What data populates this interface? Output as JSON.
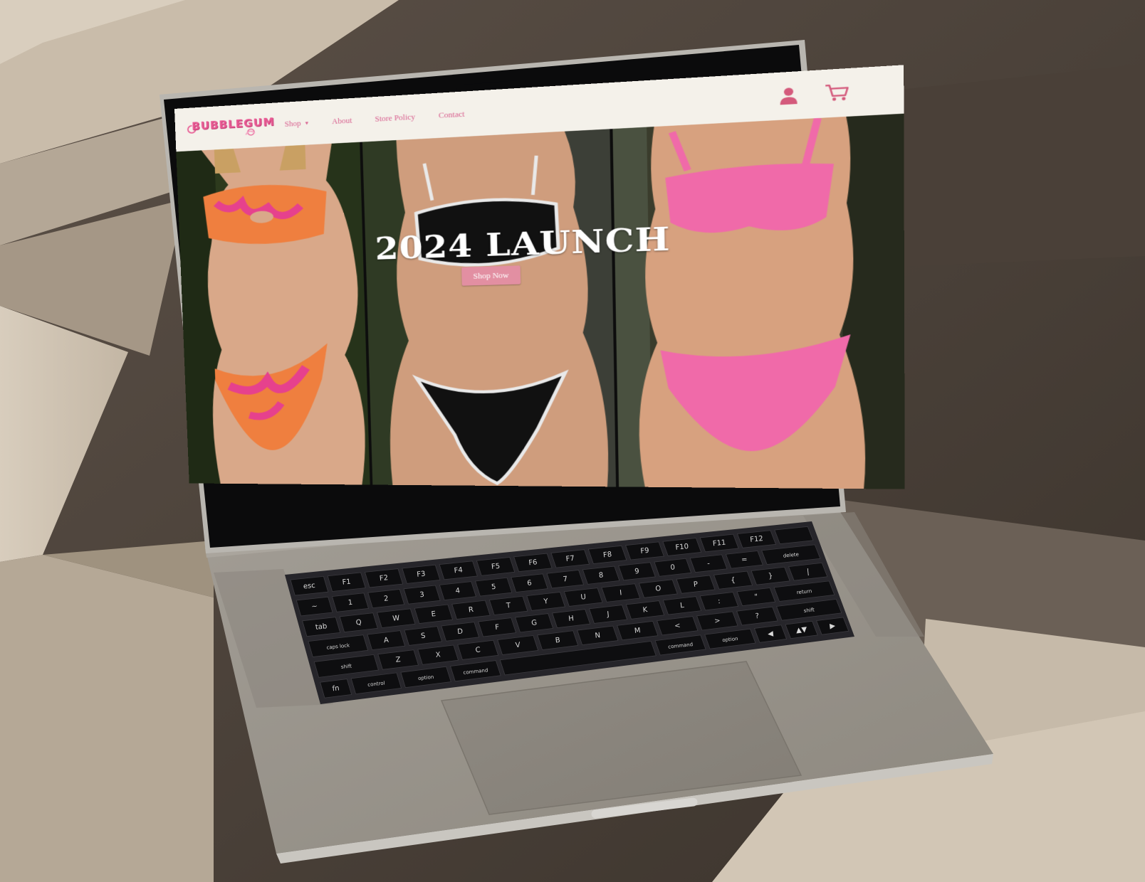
{
  "site": {
    "logo_text": "BUBBLEGUM",
    "brand_color": "#e85a93",
    "header_bg": "#f4f1ea"
  },
  "nav": {
    "items": [
      {
        "label": "Shop",
        "has_dropdown": true
      },
      {
        "label": "About",
        "has_dropdown": false
      },
      {
        "label": "Store Policy",
        "has_dropdown": false
      },
      {
        "label": "Contact",
        "has_dropdown": false
      }
    ],
    "dropdown_icon": "chevron-down-icon"
  },
  "header_icons": {
    "account": "user-icon",
    "cart": "cart-icon",
    "color": "#d45a7c"
  },
  "hero": {
    "title": "2024 LAUNCH",
    "cta_label": "Shop Now",
    "cta_color": "#e28fa2",
    "panels": [
      {
        "swimsuit": "orange-pink floral bikini"
      },
      {
        "swimsuit": "black bikini with white trim"
      },
      {
        "swimsuit": "pink textured bikini"
      }
    ]
  },
  "keyboard": {
    "rows": [
      [
        "esc",
        "F1",
        "F2",
        "F3",
        "F4",
        "F5",
        "F6",
        "F7",
        "F8",
        "F9",
        "F10",
        "F11",
        "F12",
        ""
      ],
      [
        "~",
        "1",
        "2",
        "3",
        "4",
        "5",
        "6",
        "7",
        "8",
        "9",
        "0",
        "-",
        "=",
        "delete"
      ],
      [
        "tab",
        "Q",
        "W",
        "E",
        "R",
        "T",
        "Y",
        "U",
        "I",
        "O",
        "P",
        "{",
        "}",
        "|"
      ],
      [
        "caps lock",
        "A",
        "S",
        "D",
        "F",
        "G",
        "H",
        "J",
        "K",
        "L",
        ":",
        "\"",
        "return"
      ],
      [
        "shift",
        "Z",
        "X",
        "C",
        "V",
        "B",
        "N",
        "M",
        "<",
        ">",
        "?",
        "shift"
      ],
      [
        "fn",
        "control",
        "option",
        "command",
        "",
        "command",
        "option",
        "◀",
        "▲▼",
        "▶"
      ]
    ]
  }
}
